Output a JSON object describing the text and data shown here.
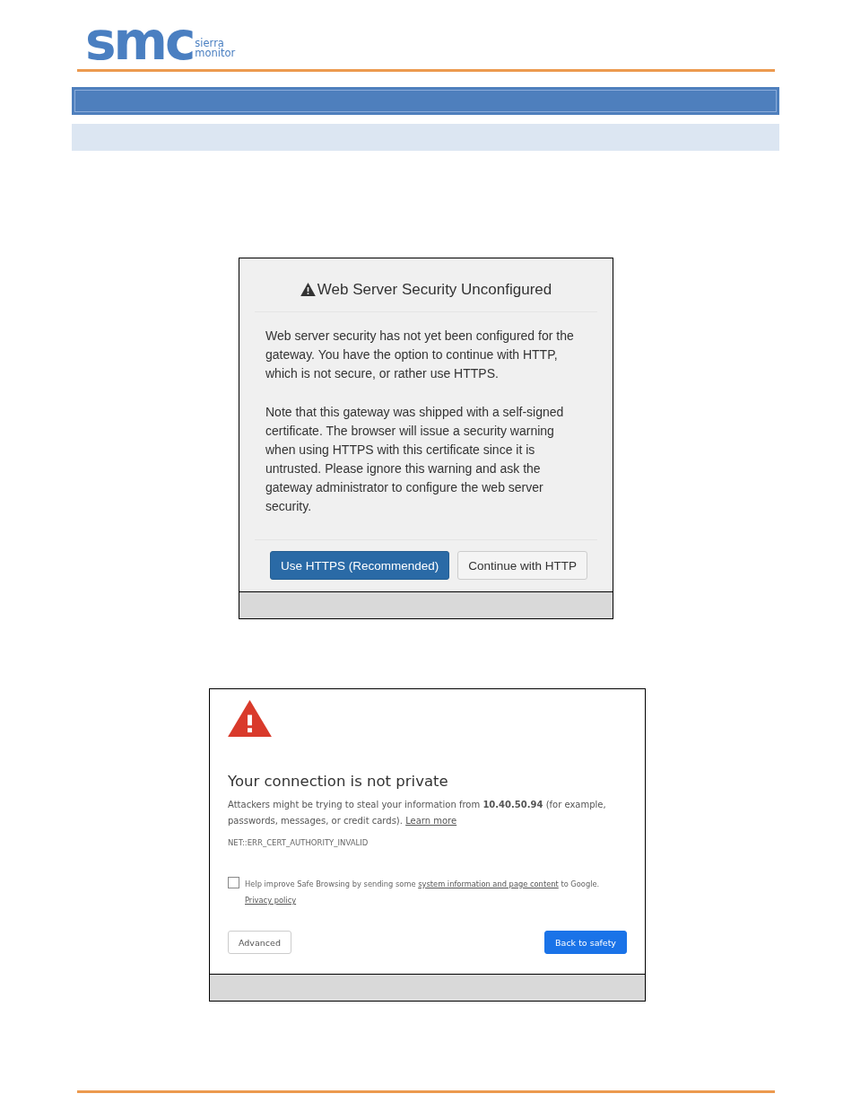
{
  "logo": {
    "mark": "smc",
    "line_1": "sierra",
    "line_2": "monitor"
  },
  "security_dialog": {
    "title": "Web Server Security Unconfigured",
    "paragraphs": [
      "Web server security has not yet been configured for the gateway. You have the option to continue with HTTP, which is not secure, or rather use HTTPS.",
      "Note that this gateway was shipped with a self-signed certificate. The browser will issue a security warning when using HTTPS with this certificate since it is untrusted. Please ignore this warning and ask the gateway administrator to configure the web server security."
    ],
    "buttons": [
      {
        "label": "Use HTTPS (Recommended)",
        "kind": "primary"
      },
      {
        "label": "Continue with HTTP",
        "kind": "default"
      }
    ]
  },
  "privacy_warning": {
    "title": "Your connection is not private",
    "body": "Attackers might be trying to steal your information from **10.40.50.94** (for example, passwords, messages, or credit cards).",
    "body_link": "Learn more",
    "error_code": "NET::ERR_CERT_AUTHORITY_INVALID",
    "checkbox": {
      "checked": false,
      "label_before": "Help improve Safe Browsing by sending some",
      "label_link": "system information and page content",
      "label_after": "to Google.",
      "privacy_link": "Privacy policy"
    },
    "buttons": [
      {
        "label": "Advanced",
        "kind": "default"
      },
      {
        "label": "Back to safety",
        "kind": "primary"
      }
    ]
  }
}
